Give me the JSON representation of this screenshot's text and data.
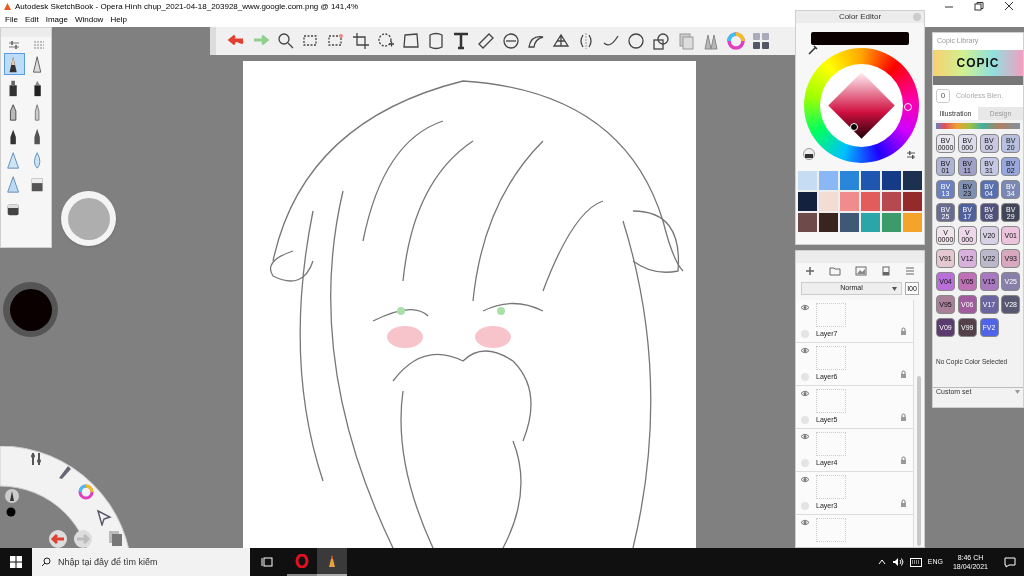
{
  "window": {
    "title": "Autodesk SketchBook - Opera Hình chụp_2021-04-18_203928_www.google.com.png @ 141,4%"
  },
  "menu": [
    "File",
    "Edit",
    "Image",
    "Window",
    "Help"
  ],
  "brush_palette": {
    "brushes": [
      {
        "selected": true
      },
      {
        "selected": false
      },
      {
        "selected": false
      },
      {
        "selected": false
      },
      {
        "selected": false
      },
      {
        "selected": false
      },
      {
        "selected": false
      },
      {
        "selected": false
      },
      {
        "selected": false
      },
      {
        "selected": false
      },
      {
        "selected": false
      },
      {
        "selected": false
      },
      {
        "selected": false
      }
    ]
  },
  "color_editor": {
    "title": "Color Editor",
    "swatches": [
      {
        "color": "#c5dcf2"
      },
      {
        "color": "#8ab8f5"
      },
      {
        "color": "#2a86d8"
      },
      {
        "color": "#1f56b0"
      },
      {
        "color": "#153a86"
      },
      {
        "color": "#1c3150"
      },
      {
        "color": "#13213f"
      },
      {
        "color": "#f2dcd4"
      },
      {
        "color": "#f08c8c"
      },
      {
        "color": "#e25c5c"
      },
      {
        "color": "#b64850"
      },
      {
        "color": "#952a2a"
      },
      {
        "color": "#6e4a4a"
      },
      {
        "color": "#3a2420"
      },
      {
        "color": "#3e5876"
      },
      {
        "color": "#2aa5a8"
      },
      {
        "color": "#3d9a6a"
      },
      {
        "color": "#f5a32a"
      }
    ]
  },
  "layers": {
    "blend_mode": "Normal",
    "opacity": "I00",
    "items": [
      {
        "name": "Layer7",
        "visible": true
      },
      {
        "name": "Layer6",
        "visible": true
      },
      {
        "name": "Layer5",
        "visible": true
      },
      {
        "name": "Layer4",
        "visible": true
      },
      {
        "name": "Layer3",
        "visible": true
      },
      {
        "visible": true
      }
    ]
  },
  "copic_library": {
    "title": "Copic Library",
    "logo": "COPIC",
    "colorless": {
      "code": "0",
      "label": "Colorless Blen."
    },
    "tabs": [
      {
        "label": "Illustration",
        "selected": true
      },
      {
        "label": "Design",
        "selected": false
      }
    ],
    "markers": [
      {
        "code": "BV 0000",
        "color": "#e8e6ee"
      },
      {
        "code": "BV 000",
        "color": "#dcdcea"
      },
      {
        "code": "BV 00",
        "color": "#c8c8e0"
      },
      {
        "code": "BV 20",
        "color": "#b8c0e0"
      },
      {
        "code": "BV 01",
        "color": "#b0b4d4"
      },
      {
        "code": "BV 11",
        "color": "#a0a0c8"
      },
      {
        "code": "BV 31",
        "color": "#c4c8e4"
      },
      {
        "code": "BV 02",
        "color": "#98a8dc"
      },
      {
        "code": "BV 13",
        "color": "#6a80c0"
      },
      {
        "code": "BV 23",
        "color": "#8090b0"
      },
      {
        "code": "BV 04",
        "color": "#5870b0"
      },
      {
        "code": "BV 34",
        "color": "#7c88b4"
      },
      {
        "code": "BV 25",
        "color": "#686c90"
      },
      {
        "code": "BV 17",
        "color": "#50609c"
      },
      {
        "code": "BV 08",
        "color": "#50507c"
      },
      {
        "code": "BV 29",
        "color": "#404658"
      },
      {
        "code": "V 0000",
        "color": "#efe4ec"
      },
      {
        "code": "V 000",
        "color": "#ecd8e8"
      },
      {
        "code": "V20",
        "color": "#d8d0e4"
      },
      {
        "code": "V01",
        "color": "#ecc4dc"
      },
      {
        "code": "V91",
        "color": "#e4c8d0"
      },
      {
        "code": "V12",
        "color": "#d8b0dc"
      },
      {
        "code": "V22",
        "color": "#bcb8cc"
      },
      {
        "code": "V93",
        "color": "#d8a8c0"
      },
      {
        "code": "V04",
        "color": "#b870d8"
      },
      {
        "code": "V05",
        "color": "#c070b4"
      },
      {
        "code": "V15",
        "color": "#a878c0"
      },
      {
        "code": "V25",
        "color": "#8880a8"
      },
      {
        "code": "V95",
        "color": "#a88098"
      },
      {
        "code": "V06",
        "color": "#a05c9c"
      },
      {
        "code": "V17",
        "color": "#6c64a0"
      },
      {
        "code": "V28",
        "color": "#585870"
      },
      {
        "code": "V09",
        "color": "#5c3c70"
      },
      {
        "code": "V99",
        "color": "#544048"
      },
      {
        "code": "FV2",
        "color": "#5064e8"
      }
    ],
    "status": "No Copic Color Selected",
    "set": "Custom set"
  },
  "taskbar": {
    "search_placeholder": "Nhập tại đây để tìm kiếm",
    "language": "ENG",
    "time": "8:46 CH",
    "date": "18/04/2021"
  }
}
